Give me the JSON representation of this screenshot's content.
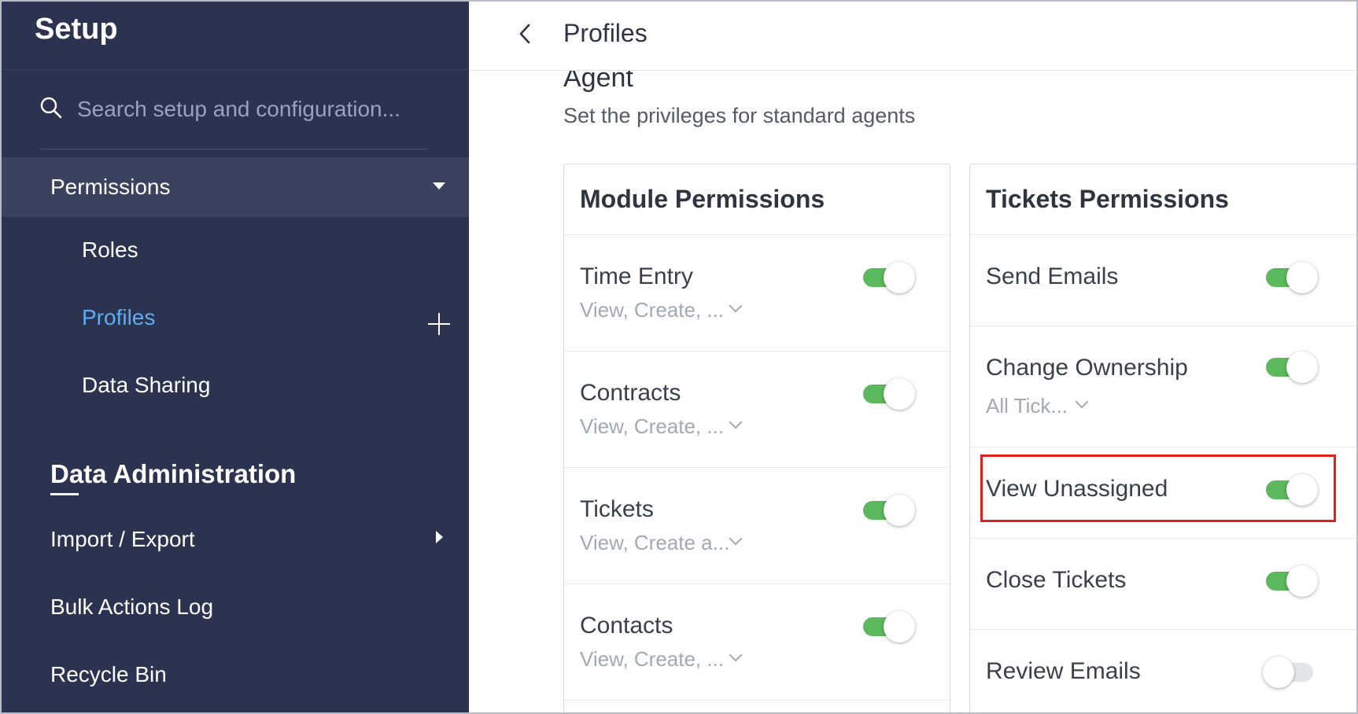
{
  "sidebar": {
    "title": "Setup",
    "search_placeholder": "Search setup and configuration...",
    "permissions_label": "Permissions",
    "sub_items": [
      {
        "label": "Roles",
        "active": false
      },
      {
        "label": "Profiles",
        "active": true
      },
      {
        "label": "Data Sharing",
        "active": false
      }
    ],
    "section_title": "Data Administration",
    "items": [
      {
        "label": "Import / Export"
      },
      {
        "label": "Bulk Actions Log"
      },
      {
        "label": "Recycle Bin"
      }
    ]
  },
  "header": {
    "title": "Profiles"
  },
  "profile": {
    "name": "Agent",
    "description": "Set the privileges for standard agents"
  },
  "module_permissions": {
    "title": "Module Permissions",
    "rows": [
      {
        "label": "Time Entry",
        "sub": "View, Create, ...",
        "enabled": true
      },
      {
        "label": "Contracts",
        "sub": "View, Create, ...",
        "enabled": true
      },
      {
        "label": "Tickets",
        "sub": "View, Create a...",
        "enabled": true
      },
      {
        "label": "Contacts",
        "sub": "View, Create, ...",
        "enabled": true
      }
    ]
  },
  "tickets_permissions": {
    "title": "Tickets Permissions",
    "rows": [
      {
        "label": "Send Emails",
        "sub": "",
        "enabled": true
      },
      {
        "label": "Change Ownership",
        "sub": "All Tick...",
        "enabled": true
      },
      {
        "label": "View Unassigned",
        "sub": "",
        "enabled": true,
        "highlighted": true
      },
      {
        "label": "Close Tickets",
        "sub": "",
        "enabled": true
      },
      {
        "label": "Review Emails",
        "sub": "",
        "enabled": false
      }
    ]
  },
  "colors": {
    "sidebar_bg": "#2b3350",
    "active_link": "#5aaef5",
    "toggle_on": "#5cb85c",
    "highlight": "#e02020"
  }
}
